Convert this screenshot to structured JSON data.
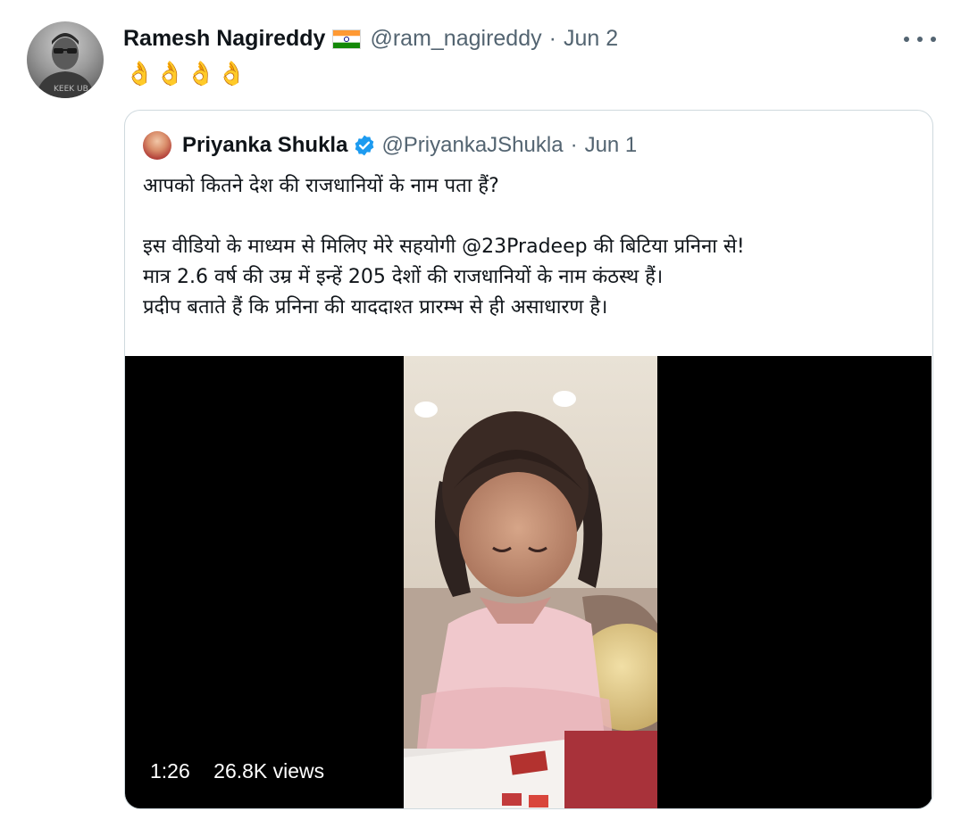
{
  "tweet": {
    "author_name": "Ramesh Nagireddy",
    "flag_emoji": "🇮🇳",
    "handle": "@ram_nagireddy",
    "separator": "·",
    "date": "Jun 2",
    "text": "👌👌👌👌"
  },
  "quoted_tweet": {
    "author_name": "Priyanka Shukla",
    "handle": "@PriyankaJShukla",
    "separator": "·",
    "date": "Jun 1",
    "lines": [
      "आपको कितने देश की राजधानियों के नाम पता  हैं?",
      "",
      "इस वीडियो के माध्यम से मिलिए मेरे सहयोगी @23Pradeep की बिटिया प्रनिना से!",
      "मात्र 2.6 वर्ष की उम्र में इन्हें 205 देशों की राजधानियों के नाम कंठस्थ हैं।",
      "प्रदीप बताते हैं कि प्रनिना की याददाश्त प्रारम्भ से ही असाधारण है।"
    ],
    "video": {
      "duration": "1:26",
      "views": "26.8K views"
    }
  },
  "icons": {
    "more": "more-options-icon",
    "verified": "verified-badge-icon"
  },
  "colors": {
    "text_primary": "#0f1419",
    "text_secondary": "#536471",
    "border": "#cfd9de",
    "verified_blue": "#1d9bf0"
  }
}
